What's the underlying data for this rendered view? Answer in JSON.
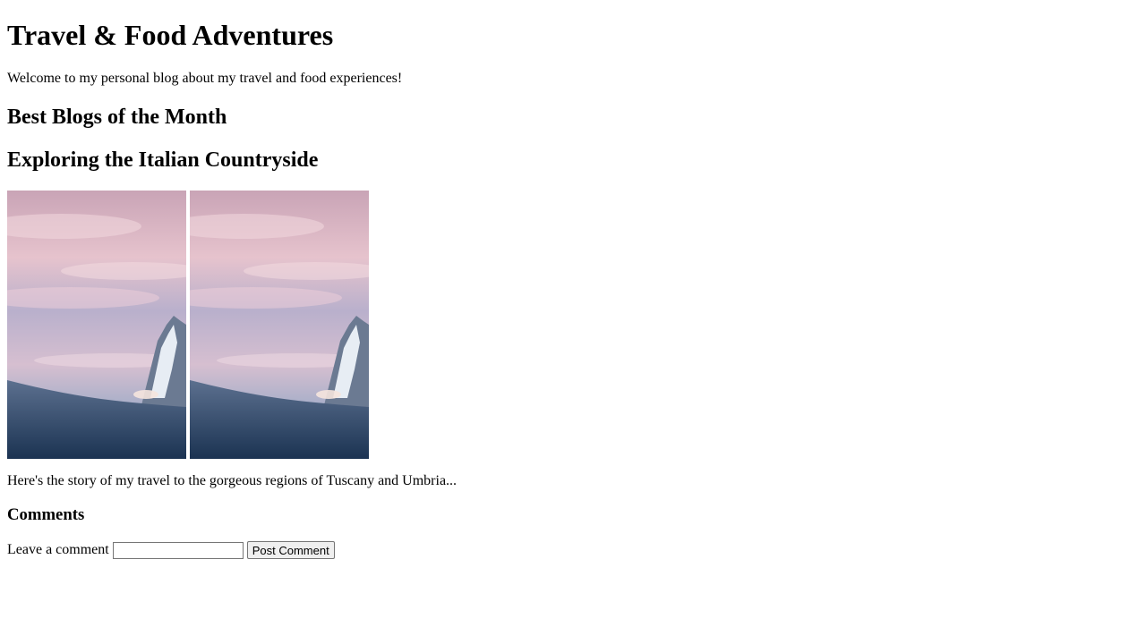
{
  "blog": {
    "title": "Travel & Food Adventures",
    "intro": "Welcome to my personal blog about my travel and food experiences!",
    "section_title": "Best Blogs of the Month"
  },
  "post": {
    "title": "Exploring the Italian Countryside",
    "images": [
      {
        "subject": "snowy-mountain-pink-sky"
      },
      {
        "subject": "snowy-mountain-pink-sky"
      }
    ],
    "excerpt": "Here's the story of my travel to the gorgeous regions of Tuscany and Umbria..."
  },
  "comments": {
    "heading": "Comments",
    "label": "Leave a comment",
    "input_value": "",
    "button_label": "Post Comment"
  }
}
